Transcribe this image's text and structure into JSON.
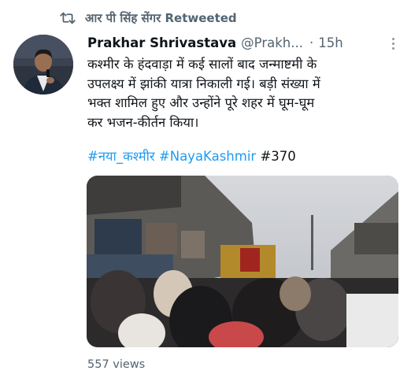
{
  "retweet": {
    "label": "आर पी सिंह सेंगर Retweeted",
    "icon": "retweet-icon"
  },
  "tweet": {
    "author_name": "Prakhar Shrivastava",
    "author_handle": "@Prakh...",
    "separator": "·",
    "time": "15h",
    "text_lines": [
      "कश्मीर के हंदवाड़ा में कई सालों बाद जन्माष्टमी के",
      "उपलक्ष्य में झांकी यात्रा निकाली गई। बड़ी संख्या में",
      "भक्त शामिल हुए और उन्होंने पूरे शहर में घूम-घूम",
      "कर भजन-कीर्तन किया।"
    ],
    "hashtags": [
      "#नया_कश्मीर",
      "#NayaKashmir"
    ],
    "plain_tag": "#370",
    "views": "557 views"
  },
  "colors": {
    "link": "#1d9bf0",
    "secondary_text": "#536471",
    "primary_text": "#0f1419"
  }
}
